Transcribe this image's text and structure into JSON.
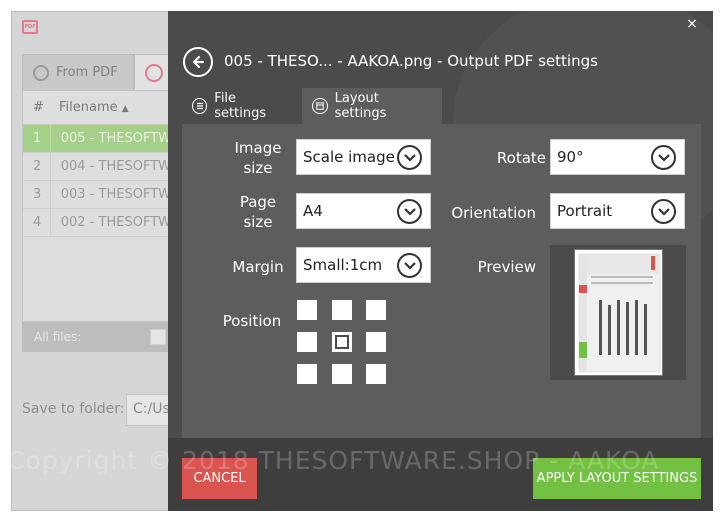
{
  "background_app": {
    "logo_text": "PDF",
    "tab_from_pdf": "From PDF",
    "table": {
      "col_num": "#",
      "col_filename": "Filename",
      "rows": [
        {
          "num": "1",
          "name": "005 - THESOFTW"
        },
        {
          "num": "2",
          "name": "004 - THESOFTW"
        },
        {
          "num": "3",
          "name": "003 - THESOFTW"
        },
        {
          "num": "4",
          "name": "002 - THESOFTW"
        }
      ]
    },
    "all_files_label": "All files:",
    "save_to_folder_label": "Save to folder:",
    "save_to_folder_value": "C:/Us"
  },
  "watermark": "Copyright © 2018  THESOFTWARE.SHOP - AAKOA",
  "dialog": {
    "close_glyph": "×",
    "title": "005 - THESO... - AAKOA.png - Output PDF settings",
    "tabs": {
      "file_settings": "File settings",
      "layout_settings": "Layout settings"
    },
    "fields": {
      "image_size_label_1": "Image",
      "image_size_label_2": "size",
      "image_size_value": "Scale image",
      "page_size_label_1": "Page",
      "page_size_label_2": "size",
      "page_size_value": "A4",
      "margin_label": "Margin",
      "margin_value": "Small:1cm",
      "position_label": "Position",
      "rotate_label": "Rotate",
      "rotate_value": "90°",
      "orientation_label": "Orientation",
      "orientation_value": "Portrait",
      "preview_label": "Preview"
    },
    "position_selected": "center",
    "buttons": {
      "cancel": "CANCEL",
      "apply": "APPLY LAYOUT SETTINGS"
    }
  },
  "colors": {
    "dialog_bg": "#4b4b4b",
    "panel_bg": "#5d5d5d",
    "footer_bg": "#3e3e3e",
    "cancel": "#d9534f",
    "apply": "#72c142",
    "selected_row": "#a6cf8a",
    "accent_pink": "#e07a8f"
  }
}
